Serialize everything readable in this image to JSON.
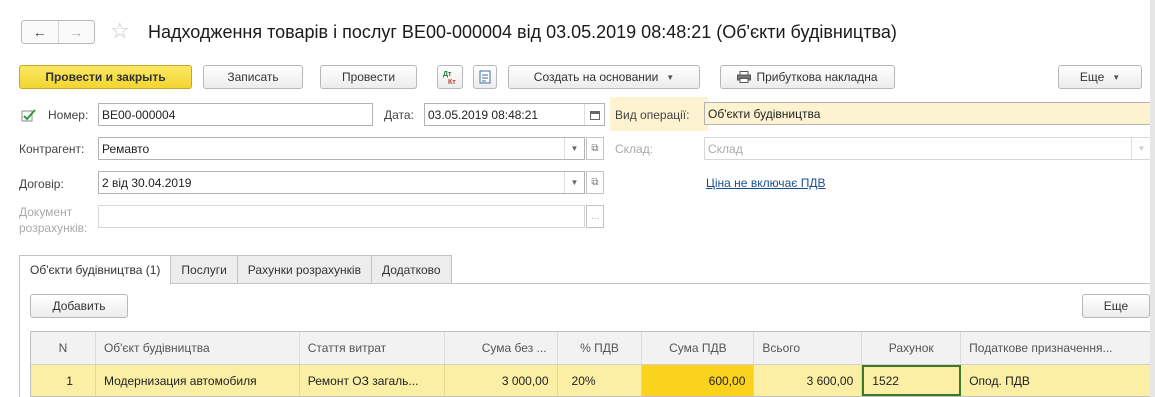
{
  "title": "Надходження товарів і послуг BE00-000004 від 03.05.2019 08:48:21 (Об'єкти будівництва)",
  "nav": {
    "back": "←",
    "forward": "→",
    "star": "☆"
  },
  "toolbar": {
    "post_close": "Провести и закрыть",
    "save": "Записать",
    "post": "Провести",
    "dt_kt": "ДтКт",
    "create_based": "Создать на основании",
    "receipt_invoice": "Прибуткова накладна",
    "more": "Еще"
  },
  "form": {
    "number_label": "Номер:",
    "number_value": "BE00-000004",
    "date_label": "Дата:",
    "date_value": "03.05.2019 08:48:21",
    "operation_label": "Вид операції:",
    "operation_value": "Об'єкти будівництва",
    "counterparty_label": "Контрагент:",
    "counterparty_value": "Ремавто",
    "warehouse_label": "Склад:",
    "warehouse_placeholder": "Склад",
    "contract_label": "Договір:",
    "contract_value": "2 від 30.04.2019",
    "vat_link": "Ціна не включає ПДВ",
    "settlement_label_1": "Документ",
    "settlement_label_2": "розрахунків:",
    "settlement_btn": "..."
  },
  "tabs": [
    {
      "label": "Об'єкти будівництва (1)"
    },
    {
      "label": "Послуги"
    },
    {
      "label": "Рахунки розрахунків"
    },
    {
      "label": "Додатково"
    }
  ],
  "tab_toolbar": {
    "add": "Добавить",
    "more": "Еще"
  },
  "table": {
    "columns": [
      "N",
      "Об'єкт будівництва",
      "Стаття витрат",
      "Сума без ...",
      "% ПДВ",
      "Сума ПДВ",
      "Всього",
      "Рахунок",
      "Податкове призначення..."
    ],
    "rows": [
      [
        "1",
        "Модернизация автомобиля",
        "Ремонт ОЗ загаль...",
        "3 000,00",
        "20%",
        "600,00",
        "3 600,00",
        "1522",
        "Опод. ПДВ"
      ]
    ]
  },
  "colors": {
    "primary": "#f2d530",
    "row_highlight": "#fbefa5",
    "cell_highlight": "#fbd31d",
    "link": "#1a4f95"
  }
}
